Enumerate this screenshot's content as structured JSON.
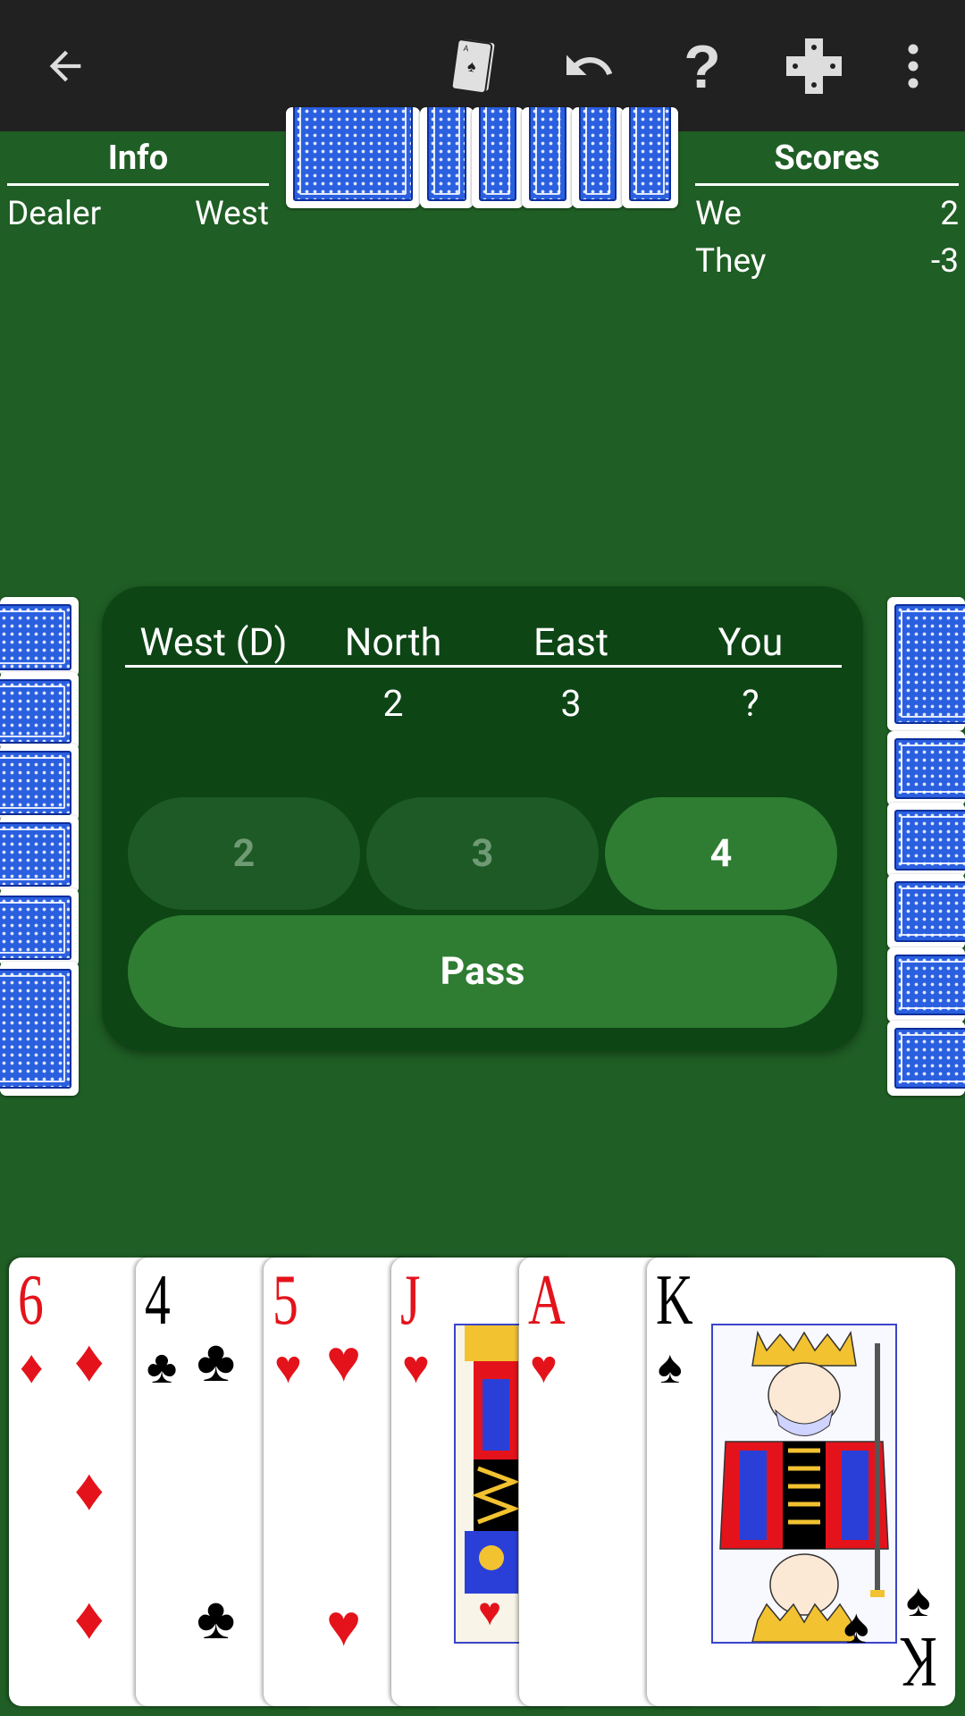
{
  "toolbar": {
    "icons": [
      "back-arrow-icon",
      "deck-icon",
      "undo-icon",
      "help-icon",
      "dpad-icon",
      "more-vert-icon"
    ]
  },
  "info": {
    "title": "Info",
    "dealer_label": "Dealer",
    "dealer_value": "West"
  },
  "scores": {
    "title": "Scores",
    "rows": [
      {
        "label": "We",
        "value": "2"
      },
      {
        "label": "They",
        "value": "-3"
      }
    ]
  },
  "bidding": {
    "headers": [
      "West (D)",
      "North",
      "East",
      "You"
    ],
    "bids": [
      "",
      "2",
      "3",
      "?"
    ],
    "buttons": [
      {
        "label": "2",
        "enabled": false
      },
      {
        "label": "3",
        "enabled": false
      },
      {
        "label": "4",
        "enabled": true
      }
    ],
    "pass_label": "Pass"
  },
  "hand": [
    {
      "rank": "6",
      "suit": "♦",
      "color": "red"
    },
    {
      "rank": "4",
      "suit": "♣",
      "color": "black"
    },
    {
      "rank": "5",
      "suit": "♥",
      "color": "red"
    },
    {
      "rank": "J",
      "suit": "♥",
      "color": "red"
    },
    {
      "rank": "A",
      "suit": "♥",
      "color": "red"
    },
    {
      "rank": "K",
      "suit": "♠",
      "color": "black"
    }
  ],
  "colors": {
    "table": "#1f5e24",
    "toolbar": "#212121",
    "bid_panel": "#0d4515",
    "button_enabled": "#2e7d32",
    "button_disabled": "#1d5a26",
    "card_back": "#2a5fe0"
  }
}
